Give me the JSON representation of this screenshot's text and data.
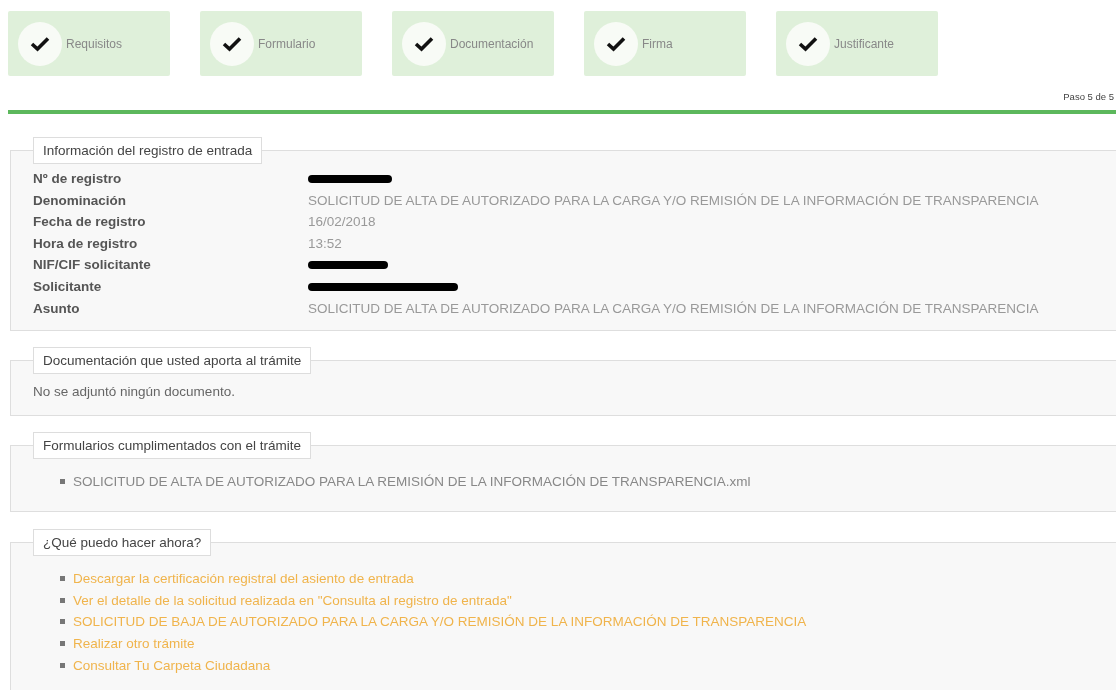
{
  "steps": [
    {
      "label": "Requisitos",
      "done": true
    },
    {
      "label": "Formulario",
      "done": true
    },
    {
      "label": "Documentación",
      "done": true
    },
    {
      "label": "Firma",
      "done": true
    },
    {
      "label": "Justificante",
      "done": true
    }
  ],
  "progress": {
    "label": "Paso 5 de 5",
    "level": 1
  },
  "registro": {
    "title": "Información del registro de entrada",
    "rows": [
      {
        "label": "Nº de registro",
        "redacted": true
      },
      {
        "label": "Denominación",
        "value": "SOLICITUD DE ALTA DE AUTORIZADO PARA LA CARGA Y/O REMISIÓN DE LA INFORMACIÓN DE TRANSPARENCIA",
        "redacted": false
      },
      {
        "label": "Fecha de registro",
        "value": "16/02/2018",
        "redacted": false
      },
      {
        "label": "Hora de registro",
        "value": "13:52",
        "redacted": false
      },
      {
        "label": "NIF/CIF solicitante",
        "redacted": true
      },
      {
        "label": "Solicitante",
        "redacted": true
      },
      {
        "label": "Asunto",
        "value": "SOLICITUD DE ALTA DE AUTORIZADO PARA LA CARGA Y/O REMISIÓN DE LA INFORMACIÓN DE TRANSPARENCIA",
        "redacted": false
      }
    ]
  },
  "documentacion": {
    "title": "Documentación que usted aporta al trámite",
    "text": "No se adjuntó ningún documento."
  },
  "formularios": {
    "title": "Formularios cumplimentados con el trámite",
    "items": [
      "SOLICITUD DE ALTA DE AUTORIZADO PARA LA REMISIÓN DE LA INFORMACIÓN DE TRANSPARENCIA.xml"
    ]
  },
  "acciones": {
    "title": "¿Qué puedo hacer ahora?",
    "links": [
      "Descargar la certificación registral del asiento de entrada",
      "Ver el detalle de la solicitud realizada en \"Consulta al registro de entrada\"",
      "SOLICITUD DE BAJA DE AUTORIZADO PARA LA CARGA Y/O REMISIÓN DE LA INFORMACIÓN DE TRANSPARENCIA",
      "Realizar otro trámite",
      "Consultar Tu Carpeta Ciudadana"
    ]
  }
}
